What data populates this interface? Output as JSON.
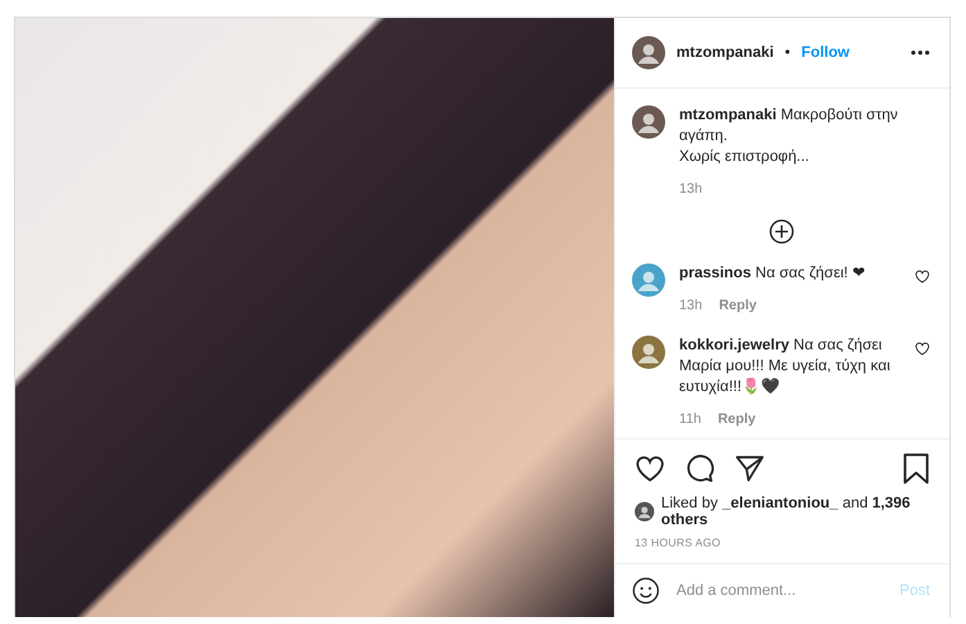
{
  "post": {
    "photo": {
      "kind": "photo"
    },
    "header": {
      "username": "mtzompanaki",
      "separator": "•",
      "follow": "Follow"
    },
    "caption": {
      "text": "**mtzompanaki** Μακροβούτι στην αγάπη.\nΧωρίς επιστροφή...",
      "time": "13h"
    },
    "comments": [
      {
        "text": "**prassinos** Να σας ζήσει! ❤",
        "time": "13h",
        "reply": "Reply",
        "liked": false
      },
      {
        "text": "**kokkori.jewelry** Να σας ζήσει Μαρία μου!!! Με υγεία, τύχη και ευτυχία!!!🌷🖤",
        "time": "11h",
        "reply": "Reply",
        "liked": false
      }
    ],
    "likes": {
      "text": "Liked by **_eleniantoniou_** and **1,396 others**"
    },
    "date": "13 HOURS AGO",
    "saved": false,
    "comment_box": {
      "placeholder": "Add a comment...",
      "post": "Post"
    }
  }
}
